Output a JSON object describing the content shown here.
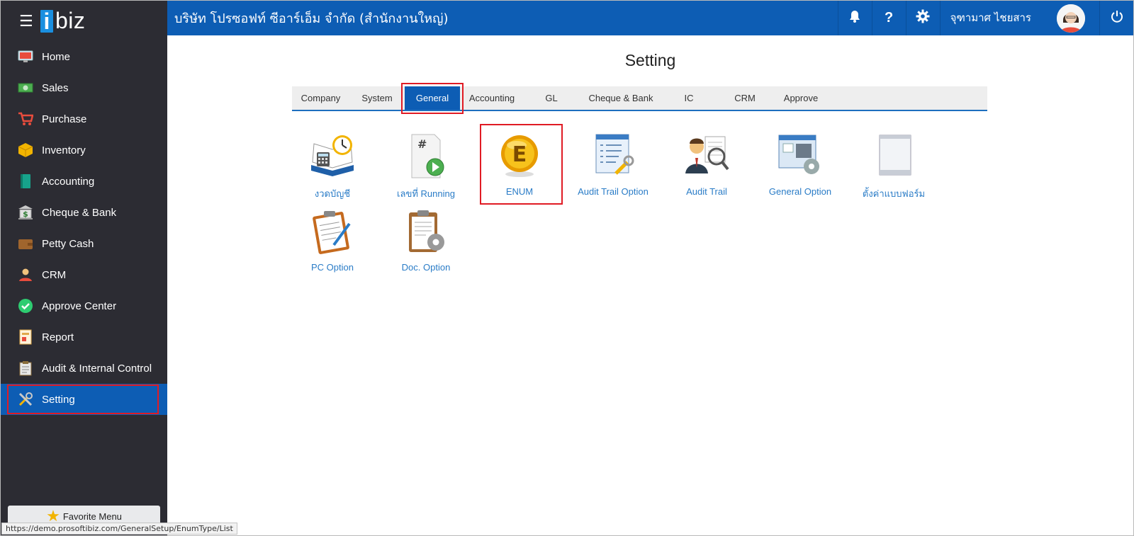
{
  "app": {
    "logo_i": "i",
    "logo_biz": "biz",
    "company_name": "บริษัท โปรซอฟท์ ซีอาร์เอ็ม จำกัด (สำนักงานใหญ่)",
    "user_name": "จุฑามาศ ไชยสาร"
  },
  "sidebar": {
    "items": [
      {
        "label": "Home",
        "icon": "monitor-icon"
      },
      {
        "label": "Sales",
        "icon": "cash-icon"
      },
      {
        "label": "Purchase",
        "icon": "cart-icon"
      },
      {
        "label": "Inventory",
        "icon": "box-icon"
      },
      {
        "label": "Accounting",
        "icon": "ledger-icon"
      },
      {
        "label": "Cheque & Bank",
        "icon": "bank-icon"
      },
      {
        "label": "Petty Cash",
        "icon": "wallet-icon"
      },
      {
        "label": "CRM",
        "icon": "people-icon"
      },
      {
        "label": "Approve Center",
        "icon": "check-circle-icon"
      },
      {
        "label": "Report",
        "icon": "report-icon"
      },
      {
        "label": "Audit & Internal Control",
        "icon": "clipboard-icon"
      },
      {
        "label": "Setting",
        "icon": "tools-icon",
        "active": true
      }
    ],
    "favorite_label": "Favorite Menu"
  },
  "status_url": "https://demo.prosoftibiz.com/GeneralSetup/EnumType/List",
  "main": {
    "title": "Setting",
    "tabs": [
      {
        "label": "Company"
      },
      {
        "label": "System"
      },
      {
        "label": "General",
        "active": true
      },
      {
        "label": "Accounting"
      },
      {
        "label": "GL"
      },
      {
        "label": "Cheque & Bank"
      },
      {
        "label": "IC"
      },
      {
        "label": "CRM"
      },
      {
        "label": "Approve"
      }
    ],
    "tiles": [
      {
        "label": "งวดบัญชี",
        "icon": "calendar-book-icon"
      },
      {
        "label": "เลขที่ Running",
        "icon": "running-number-icon"
      },
      {
        "label": "ENUM",
        "icon": "enum-coin-icon",
        "selected": true
      },
      {
        "label": "Audit Trail Option",
        "icon": "audit-option-icon"
      },
      {
        "label": "Audit Trail",
        "icon": "audit-trail-icon"
      },
      {
        "label": "General Option",
        "icon": "general-option-icon"
      },
      {
        "label": "ตั้งค่าแบบฟอร์ม",
        "icon": "form-setting-icon"
      },
      {
        "label": "PC Option",
        "icon": "pc-option-icon"
      },
      {
        "label": "Doc. Option",
        "icon": "doc-option-icon"
      }
    ]
  },
  "colors": {
    "topbar": "#0d5db4",
    "sidebar": "#2c2c33",
    "highlight": "#e01b24",
    "link": "#2a7cc7"
  }
}
